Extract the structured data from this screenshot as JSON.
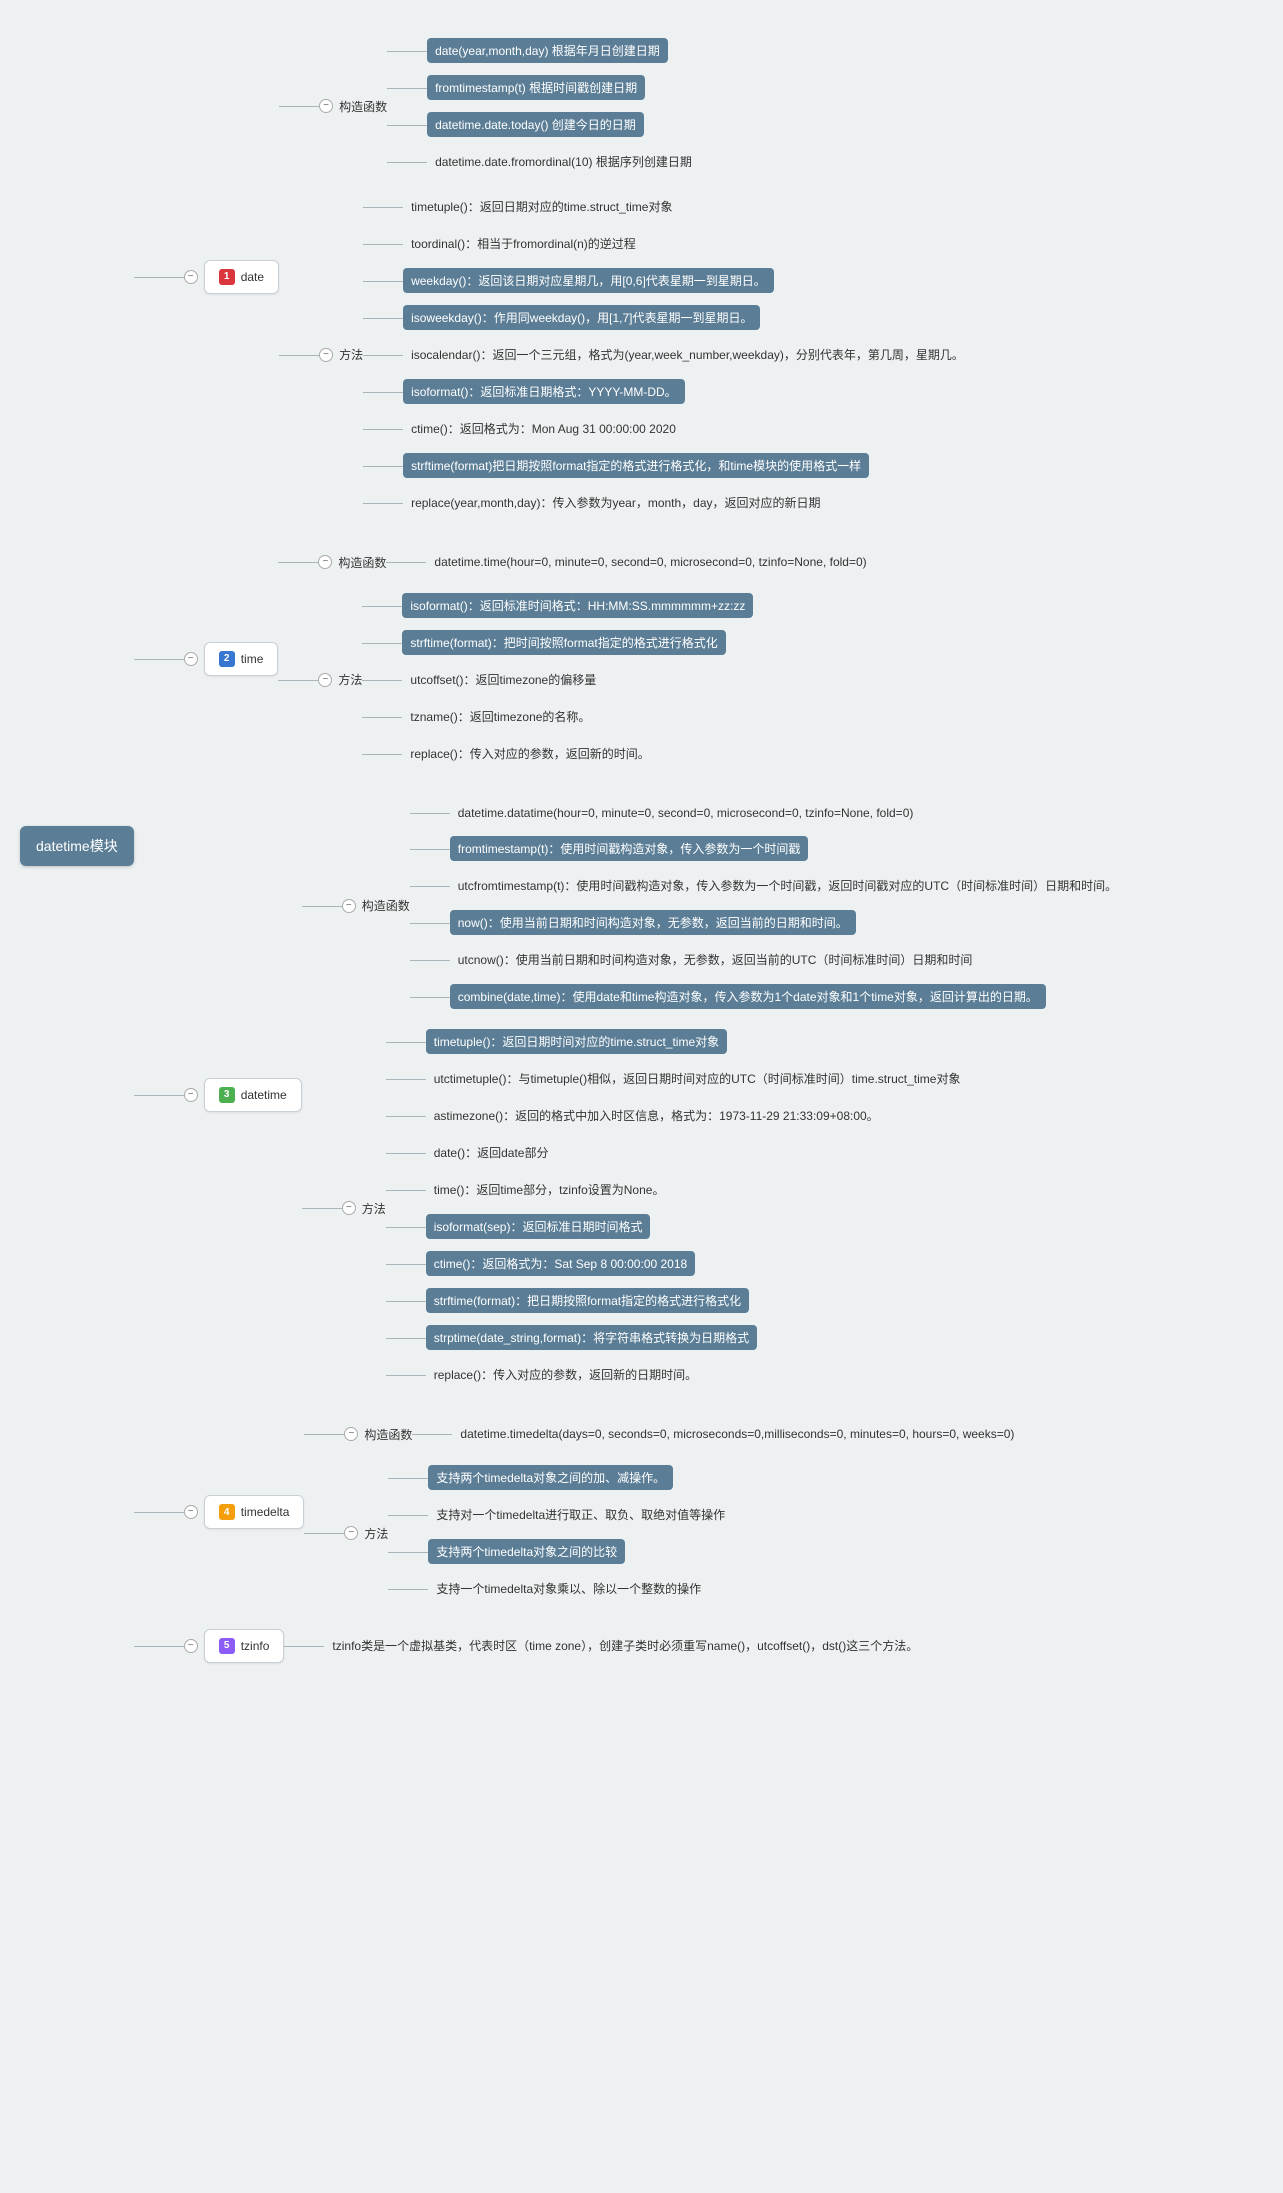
{
  "root": "datetime模块",
  "nodes": [
    {
      "num": "1",
      "badge": "nb-red",
      "title": "date",
      "groups": [
        {
          "label": "构造函数",
          "leaves": [
            {
              "text": "date(year,month,day) 根据年月日创建日期",
              "hl": true
            },
            {
              "text": "fromtimestamp(t) 根据时间戳创建日期",
              "hl": true
            },
            {
              "text": "datetime.date.today() 创建今日的日期",
              "hl": true
            },
            {
              "text": "datetime.date.fromordinal(10) 根据序列创建日期",
              "hl": false
            }
          ]
        },
        {
          "label": "方法",
          "leaves": [
            {
              "text": "timetuple()：返回日期对应的time.struct_time对象",
              "hl": false
            },
            {
              "text": "toordinal()：相当于fromordinal(n)的逆过程",
              "hl": false
            },
            {
              "text": "weekday()：返回该日期对应星期几，用[0,6]代表星期一到星期日。",
              "hl": true
            },
            {
              "text": "isoweekday()：作用同weekday()，用[1,7]代表星期一到星期日。",
              "hl": true
            },
            {
              "text": "isocalendar()：返回一个三元组，格式为(year,week_number,weekday)，分别代表年，第几周，星期几。",
              "hl": false
            },
            {
              "text": "isoformat()：返回标准日期格式：YYYY-MM-DD。",
              "hl": true
            },
            {
              "text": "ctime()：返回格式为：Mon Aug 31 00:00:00 2020",
              "hl": false
            },
            {
              "text": "strftime(format)把日期按照format指定的格式进行格式化，和time模块的使用格式一样",
              "hl": true
            },
            {
              "text": "replace(year,month,day)：传入参数为year，month，day，返回对应的新日期",
              "hl": false
            }
          ]
        }
      ]
    },
    {
      "num": "2",
      "badge": "nb-blue",
      "title": "time",
      "groups": [
        {
          "label": "构造函数",
          "leaves": [
            {
              "text": "datetime.time(hour=0, minute=0, second=0, microsecond=0, tzinfo=None, fold=0)",
              "hl": false
            }
          ]
        },
        {
          "label": "方法",
          "leaves": [
            {
              "text": "isoformat()：返回标准时间格式：HH:MM:SS.mmmmmm+zz:zz",
              "hl": true
            },
            {
              "text": "strftime(format)：把时间按照format指定的格式进行格式化",
              "hl": true
            },
            {
              "text": "utcoffset()：返回timezone的偏移量",
              "hl": false
            },
            {
              "text": "tzname()：返回timezone的名称。",
              "hl": false
            },
            {
              "text": "replace()：传入对应的参数，返回新的时间。",
              "hl": false
            }
          ]
        }
      ]
    },
    {
      "num": "3",
      "badge": "nb-green",
      "title": "datetime",
      "groups": [
        {
          "label": "构造函数",
          "leaves": [
            {
              "text": "datetime.datatime(hour=0, minute=0, second=0, microsecond=0, tzinfo=None, fold=0)",
              "hl": false
            },
            {
              "text": "fromtimestamp(t)：使用时间戳构造对象，传入参数为一个时间戳",
              "hl": true
            },
            {
              "text": "utcfromtimestamp(t)：使用时间戳构造对象，传入参数为一个时间戳，返回时间戳对应的UTC（时间标准时间）日期和时间。",
              "hl": false
            },
            {
              "text": "now()：使用当前日期和时间构造对象，无参数，返回当前的日期和时间。",
              "hl": true
            },
            {
              "text": "utcnow()：使用当前日期和时间构造对象，无参数，返回当前的UTC（时间标准时间）日期和时间",
              "hl": false
            },
            {
              "text": "combine(date,time)：使用date和time构造对象，传入参数为1个date对象和1个time对象，返回计算出的日期。",
              "hl": true
            }
          ]
        },
        {
          "label": "方法",
          "leaves": [
            {
              "text": "timetuple()：返回日期时间对应的time.struct_time对象",
              "hl": true
            },
            {
              "text": "utctimetuple()：与timetuple()相似，返回日期时间对应的UTC（时间标准时间）time.struct_time对象",
              "hl": false
            },
            {
              "text": "astimezone()：返回的格式中加入时区信息，格式为：1973-11-29 21:33:09+08:00。",
              "hl": false
            },
            {
              "text": "date()：返回date部分",
              "hl": false
            },
            {
              "text": "time()：返回time部分，tzinfo设置为None。",
              "hl": false
            },
            {
              "text": "isoformat(sep)：返回标准日期时间格式",
              "hl": true
            },
            {
              "text": "ctime()：返回格式为：Sat Sep 8 00:00:00 2018",
              "hl": true
            },
            {
              "text": "strftime(format)：把日期按照format指定的格式进行格式化",
              "hl": true
            },
            {
              "text": "strptime(date_string,format)：将字符串格式转换为日期格式",
              "hl": true
            },
            {
              "text": "replace()：传入对应的参数，返回新的日期时间。",
              "hl": false
            }
          ]
        }
      ]
    },
    {
      "num": "4",
      "badge": "nb-orange",
      "title": "timedelta",
      "groups": [
        {
          "label": "构造函数",
          "leaves": [
            {
              "text": "datetime.timedelta(days=0, seconds=0, microseconds=0,milliseconds=0, minutes=0, hours=0, weeks=0)",
              "hl": false
            }
          ]
        },
        {
          "label": "方法",
          "leaves": [
            {
              "text": "支持两个timedelta对象之间的加、减操作。",
              "hl": true
            },
            {
              "text": "支持对一个timedelta进行取正、取负、取绝对值等操作",
              "hl": false
            },
            {
              "text": "支持两个timedelta对象之间的比较",
              "hl": true
            },
            {
              "text": "支持一个timedelta对象乘以、除以一个整数的操作",
              "hl": false
            }
          ]
        }
      ]
    },
    {
      "num": "5",
      "badge": "nb-purple",
      "title": "tzinfo",
      "direct_leaf": {
        "text": "tzinfo类是一个虚拟基类，代表时区（time zone），创建子类时必须重写name()，utcoffset()，dst()这三个方法。",
        "hl": false
      }
    }
  ]
}
